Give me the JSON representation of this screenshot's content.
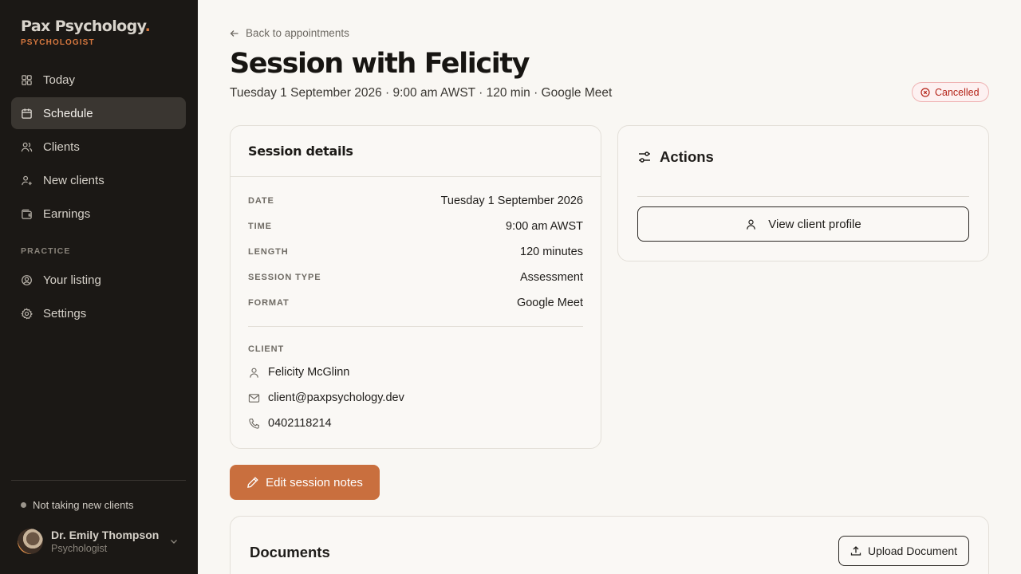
{
  "brand": {
    "name": "Pax Psychology",
    "dot": ".",
    "subtitle": "PSYCHOLOGIST",
    "accent_color": "#d7783f"
  },
  "sidebar": {
    "items": [
      {
        "label": "Today",
        "icon": "dashboard-icon"
      },
      {
        "label": "Schedule",
        "icon": "calendar-icon",
        "active": true
      },
      {
        "label": "Clients",
        "icon": "users-icon"
      },
      {
        "label": "New clients",
        "icon": "user-plus-icon"
      },
      {
        "label": "Earnings",
        "icon": "wallet-icon"
      }
    ],
    "section_label": "PRACTICE",
    "practice_items": [
      {
        "label": "Your listing",
        "icon": "user-circle-icon"
      },
      {
        "label": "Settings",
        "icon": "gear-icon"
      }
    ],
    "status": "Not taking new clients",
    "user": {
      "name": "Dr. Emily Thompson",
      "role": "Psychologist"
    }
  },
  "header": {
    "back_label": "Back to appointments",
    "title": "Session with Felicity",
    "subtitle": "Tuesday 1 September 2026 · 9:00 am AWST · 120 min · Google Meet",
    "status_badge": "Cancelled",
    "status_color": "#b42318"
  },
  "details": {
    "title": "Session details",
    "rows": [
      {
        "label": "DATE",
        "value": "Tuesday 1 September 2026"
      },
      {
        "label": "TIME",
        "value": "9:00 am AWST"
      },
      {
        "label": "LENGTH",
        "value": "120 minutes"
      },
      {
        "label": "SESSION TYPE",
        "value": "Assessment"
      },
      {
        "label": "FORMAT",
        "value": "Google Meet"
      }
    ],
    "client_label": "CLIENT",
    "client": {
      "name": "Felicity McGlinn",
      "email": "client@paxpsychology.dev",
      "phone": "0402118214"
    }
  },
  "actions": {
    "title": "Actions",
    "view_profile": "View client profile"
  },
  "edit_notes": "Edit session notes",
  "documents": {
    "title": "Documents",
    "upload": "Upload Document"
  }
}
